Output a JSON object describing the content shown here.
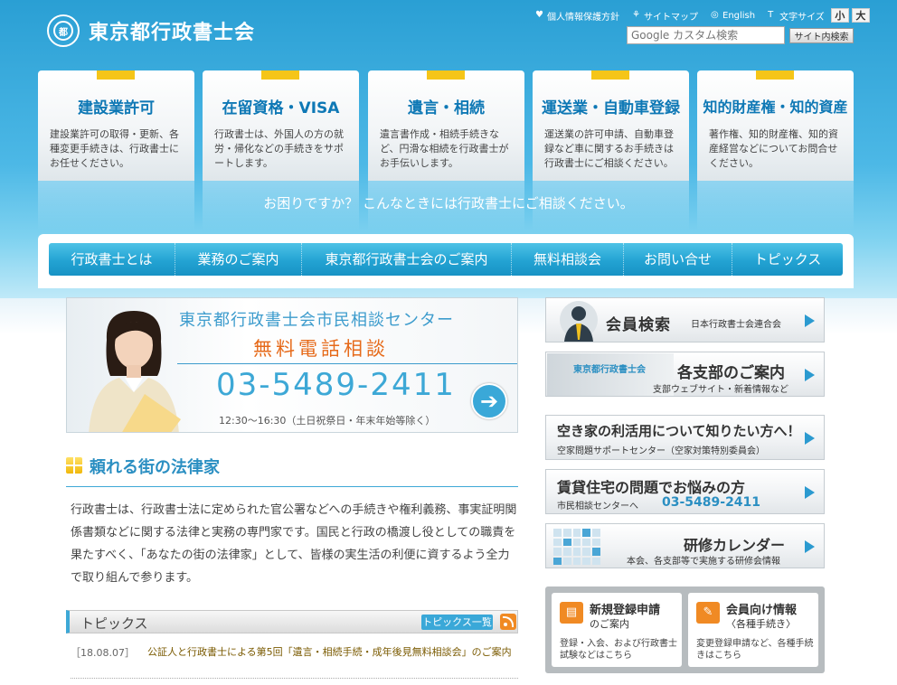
{
  "header": {
    "logo_mark": "都",
    "site_title": "東京都行政書士会",
    "util_links": [
      "個人情報保護方針",
      "サイトマップ",
      "English"
    ],
    "font_size_label": "文字サイズ",
    "font_small": "小",
    "font_large": "大",
    "search_placeholder": "Google カスタム検索",
    "search_button": "サイト内検索"
  },
  "cards": [
    {
      "title": "建設業許可",
      "desc": "建設業許可の取得・更新、各種変更手続きは、行政書士にお任せください。"
    },
    {
      "title": "在留資格・VISA",
      "desc": "行政書士は、外国人の方の就労・帰化などの手続きをサポートします。"
    },
    {
      "title": "遺言・相続",
      "desc": "遺言書作成・相続手続きなど、円滑な相続を行政書士がお手伝いします。"
    },
    {
      "title": "運送業・自動車登録",
      "desc": "運送業の許可申請、自動車登録など車に関するお手続きは行政書士にご相談ください。"
    },
    {
      "title": "知的財産権・知的資産",
      "desc": "著作権、知的財産権、知的資産経営などについてお問合せください。"
    }
  ],
  "help_text": "お困りですか？ こんなときには行政書士にご相談ください。",
  "nav": [
    "行政書士とは",
    "業務のご案内",
    "東京都行政書士会のご案内",
    "無料相談会",
    "お問い合せ",
    "トピックス"
  ],
  "banner": {
    "line1": "東京都行政書士会市民相談センター",
    "line2": "無料電話相談",
    "phone": "03-5489-2411",
    "hours": "12:30〜16:30（土日祝祭日・年末年始等除く）"
  },
  "section": {
    "title": "頼れる街の法律家",
    "intro": "行政書士は、行政書士法に定められた官公署などへの手続きや権利義務、事実証明関係書類などに関する法律と実務の専門家です。国民と行政の橋渡し役としての職責を果たすべく、「あなたの街の法律家」として、皆様の実生活の利便に資するよう全力で取り組んで参ります。"
  },
  "topics": {
    "title": "トピックス",
    "list_button": "トピックス一覧",
    "items": [
      {
        "date": "［18.08.07］",
        "text": "公証人と行政書士による第5回「遺言・相続手続・成年後見無料相談会」のご案内"
      }
    ]
  },
  "right": {
    "member_search": {
      "title": "会員検索",
      "sub": "日本行政書士会連合会"
    },
    "branches": {
      "tag": "東京都行政書士会",
      "title": "各支部のご案内",
      "sub": "支部ウェブサイト・新着情報など"
    },
    "vacant": {
      "title": "空き家の利活用について知りたい方へ！",
      "sub": "空家問題サポートセンター（空家対策特別委員会）"
    },
    "rental": {
      "title": "賃貸住宅の問題でお悩みの方",
      "sub": "市民相談センターへ",
      "tel": "03-5489-2411"
    },
    "training": {
      "title": "研修カレンダー",
      "sub": "本会、各支部等で実施する研修会情報"
    },
    "registration": {
      "title": "新規登録申請",
      "sub": "のご案内",
      "desc": "登録・入会、および行政書士試験などはこちら"
    },
    "members": {
      "title": "会員向け情報",
      "sub": "〈各種手続き〉",
      "desc": "変更登録申請など、各種手続きはこちら"
    }
  }
}
